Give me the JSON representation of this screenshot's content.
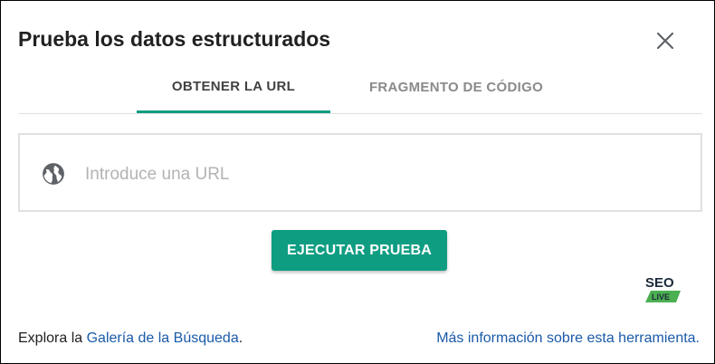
{
  "dialog": {
    "title": "Prueba los datos estructurados",
    "close_icon": "close-icon"
  },
  "tabs": [
    {
      "label": "OBTENER LA URL",
      "active": true
    },
    {
      "label": "FRAGMENTO DE CÓDIGO",
      "active": false
    }
  ],
  "url_field": {
    "icon": "globe-icon",
    "placeholder": "Introduce una URL",
    "value": ""
  },
  "run_button": {
    "label": "EJECUTAR PRUEBA"
  },
  "watermark": {
    "top": "SEO",
    "bottom": "LIVE",
    "icon": "seo-alive-logo"
  },
  "footer": {
    "explore_prefix": "Explora la ",
    "gallery_link": "Galería de la Búsqueda",
    "explore_suffix": ".",
    "more_info_link": "Más información sobre esta herramienta."
  },
  "colors": {
    "accent": "#0f9d82",
    "link": "#1a5aa8",
    "title_text": "#212121",
    "inactive_tab": "#8a8a8a"
  }
}
